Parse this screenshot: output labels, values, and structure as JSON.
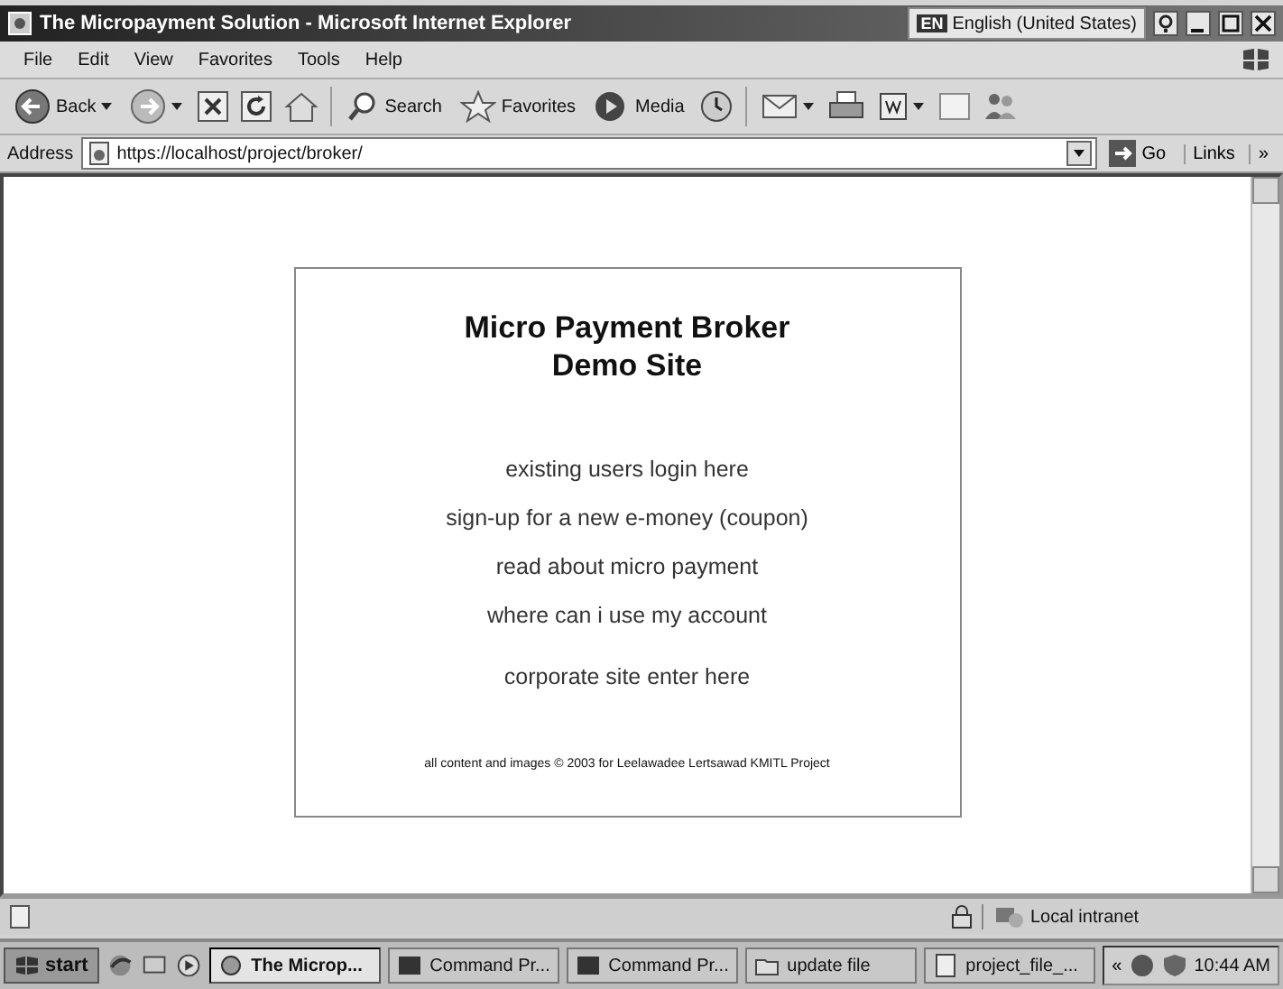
{
  "window": {
    "title": "The Micropayment Solution - Microsoft Internet Explorer"
  },
  "language_bar": {
    "badge": "EN",
    "label": "English (United States)"
  },
  "menu": [
    "File",
    "Edit",
    "View",
    "Favorites",
    "Tools",
    "Help"
  ],
  "toolbar": {
    "labels": [
      "Back",
      "Search",
      "Favorites",
      "Media"
    ]
  },
  "address_bar": {
    "label": "Address",
    "value": "https://localhost/project/broker/",
    "go": "Go",
    "links": "Links",
    "more": "»"
  },
  "page": {
    "heading": "Micro Payment Broker Demo Site",
    "links": [
      "existing users login here",
      "sign-up for a new e-money (coupon)",
      "read about micro payment",
      "where can i use my account"
    ],
    "corporate_link": "corporate site enter here",
    "footer": "all content and images © 2003 for Leelawadee Lertsawad KMITL Project"
  },
  "status_bar": {
    "zone": "Local intranet"
  },
  "taskbar": {
    "start": "start",
    "tasks": [
      {
        "label": "The Microp...",
        "selected": true
      },
      {
        "label": "Command Pr...",
        "selected": false
      },
      {
        "label": "Command Pr...",
        "selected": false
      },
      {
        "label": "update file",
        "selected": false
      },
      {
        "label": "project_file_...",
        "selected": false
      }
    ],
    "chevron": "«",
    "clock": "10:44 AM"
  }
}
